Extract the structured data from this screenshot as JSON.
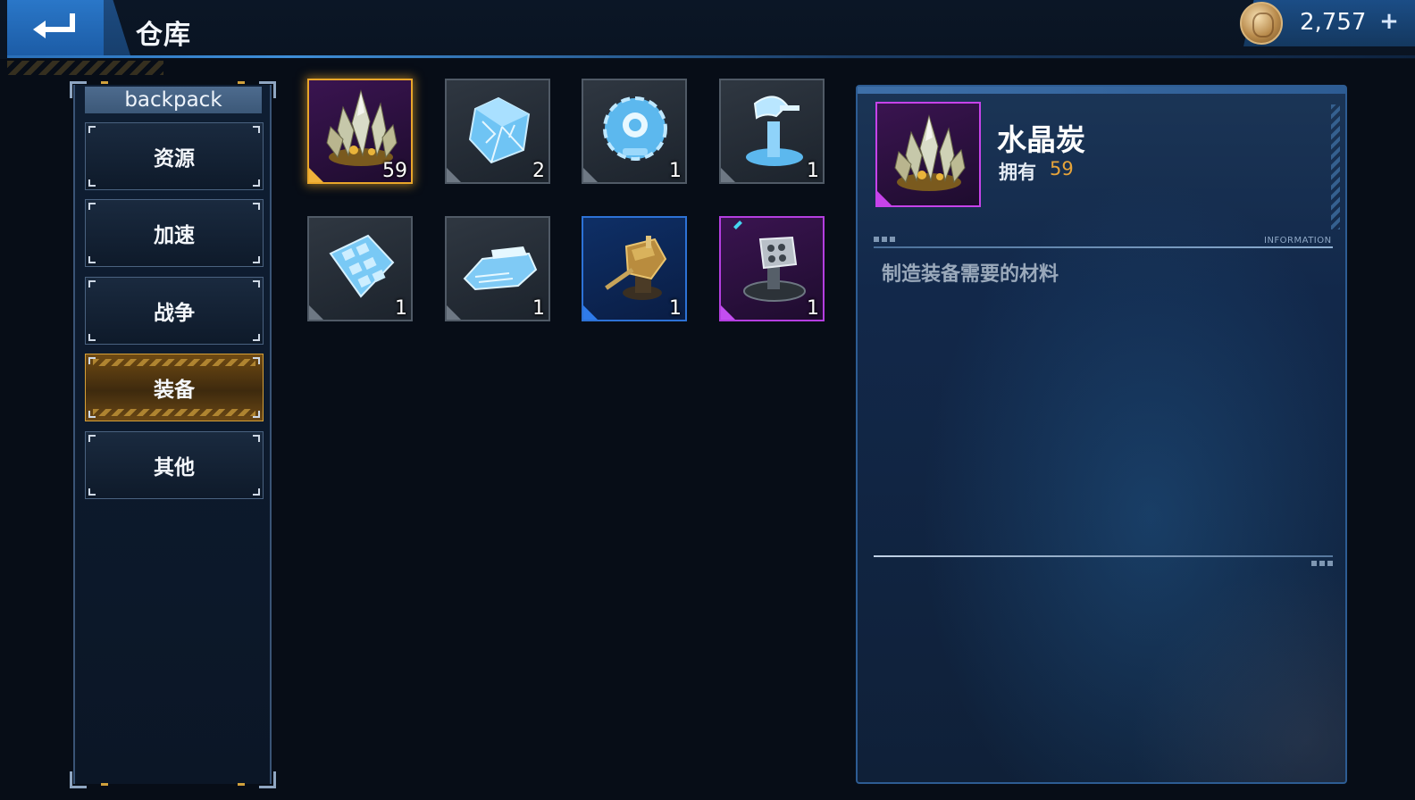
{
  "header": {
    "title": "仓库",
    "back_icon": "return-arrow-icon",
    "currency": {
      "icon": "gold-coin-icon",
      "amount": "2,757",
      "add_label": "+"
    }
  },
  "sidebar": {
    "label": "backpack",
    "tabs": [
      {
        "label": "资源",
        "active": false
      },
      {
        "label": "加速",
        "active": false
      },
      {
        "label": "战争",
        "active": false
      },
      {
        "label": "装备",
        "active": true
      },
      {
        "label": "其他",
        "active": false
      }
    ]
  },
  "items": [
    {
      "icon": "crystal-cluster-icon",
      "qty": "59",
      "rarity": "purple",
      "selected": true
    },
    {
      "icon": "blue-cube-crystal-icon",
      "qty": "2",
      "rarity": "grey"
    },
    {
      "icon": "blue-gear-core-icon",
      "qty": "1",
      "rarity": "grey"
    },
    {
      "icon": "blue-radar-dish-icon",
      "qty": "1",
      "rarity": "grey"
    },
    {
      "icon": "blue-armor-plate-icon",
      "qty": "1",
      "rarity": "grey"
    },
    {
      "icon": "blue-engine-pod-icon",
      "qty": "1",
      "rarity": "grey"
    },
    {
      "icon": "gold-cannon-turret-icon",
      "qty": "1",
      "rarity": "blue"
    },
    {
      "icon": "grey-missile-turret-icon",
      "qty": "1",
      "rarity": "purple"
    }
  ],
  "detail": {
    "icon": "crystal-cluster-icon",
    "name": "水晶炭",
    "owned_label": "拥有",
    "owned_value": "59",
    "section_tag": "INFORMATION",
    "description": "制造装备需要的材料"
  },
  "colors": {
    "accent_blue": "#2a77c8",
    "active_tab_gold": "#d6a038",
    "owned_value": "#e7a43a",
    "rarity_purple": "#b43ee0",
    "rarity_blue": "#2d72d6"
  }
}
